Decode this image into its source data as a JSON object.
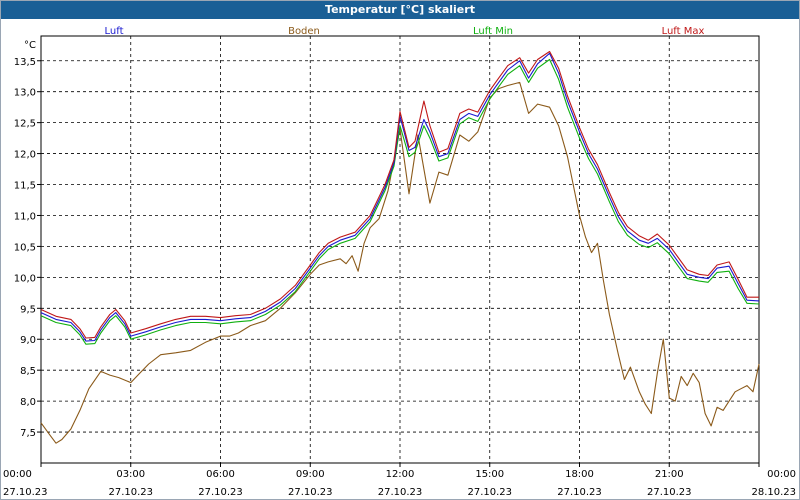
{
  "window": {
    "title": "Temperatur [°C] skaliert"
  },
  "chart_data": {
    "type": "line",
    "title": "Temperatur [°C] skaliert",
    "ylabel": "°C",
    "xlabel": "",
    "ylim": [
      7.0,
      13.9
    ],
    "grid": true,
    "legend": "top",
    "y_ticks": [
      "7,5",
      "8,0",
      "8,5",
      "9,0",
      "9,5",
      "10,0",
      "10,5",
      "11,0",
      "11,5",
      "12,0",
      "12,5",
      "13,0",
      "13,5"
    ],
    "x_ticks": [
      {
        "h": 0,
        "time": "00:00",
        "date": "27.10.23"
      },
      {
        "h": 3,
        "time": "03:00",
        "date": "27.10.23"
      },
      {
        "h": 6,
        "time": "06:00",
        "date": "27.10.23"
      },
      {
        "h": 9,
        "time": "09:00",
        "date": "27.10.23"
      },
      {
        "h": 12,
        "time": "12:00",
        "date": "27.10.23"
      },
      {
        "h": 15,
        "time": "15:00",
        "date": "27.10.23"
      },
      {
        "h": 18,
        "time": "18:00",
        "date": "27.10.23"
      },
      {
        "h": 21,
        "time": "21:00",
        "date": "27.10.23"
      },
      {
        "h": 24,
        "time": "00:00",
        "date": "28.10.23"
      }
    ],
    "series": [
      {
        "name": "Luft",
        "color": "#1a1ad0",
        "x": [
          0,
          0.5,
          1,
          1.3,
          1.5,
          1.8,
          2,
          2.3,
          2.5,
          2.8,
          3,
          3.5,
          4,
          4.5,
          5,
          5.5,
          6,
          6.5,
          7,
          7.5,
          8,
          8.5,
          9,
          9.3,
          9.6,
          10,
          10.5,
          11,
          11.5,
          11.8,
          12,
          12.3,
          12.5,
          12.8,
          13,
          13.3,
          13.6,
          14,
          14.3,
          14.6,
          15,
          15.3,
          15.6,
          16,
          16.3,
          16.6,
          17,
          17.3,
          17.6,
          18,
          18.3,
          18.6,
          19,
          19.3,
          19.6,
          20,
          20.3,
          20.6,
          21,
          21.3,
          21.6,
          22,
          22.3,
          22.6,
          23,
          23.3,
          23.6,
          24
        ],
        "values": [
          9.43,
          9.32,
          9.27,
          9.12,
          8.97,
          8.98,
          9.15,
          9.35,
          9.43,
          9.25,
          9.05,
          9.12,
          9.2,
          9.27,
          9.32,
          9.32,
          9.3,
          9.33,
          9.35,
          9.45,
          9.6,
          9.82,
          10.15,
          10.35,
          10.5,
          10.6,
          10.68,
          10.95,
          11.45,
          11.85,
          12.6,
          12.05,
          12.1,
          12.55,
          12.35,
          11.95,
          12.0,
          12.55,
          12.65,
          12.6,
          12.95,
          13.15,
          13.35,
          13.5,
          13.22,
          13.45,
          13.62,
          13.3,
          12.85,
          12.35,
          12.0,
          11.75,
          11.3,
          10.98,
          10.75,
          10.6,
          10.55,
          10.63,
          10.45,
          10.25,
          10.05,
          10.0,
          9.98,
          10.15,
          10.18,
          9.9,
          9.63,
          9.62
        ]
      },
      {
        "name": "Boden",
        "color": "#8b5a1a",
        "x": [
          0,
          0.3,
          0.5,
          0.7,
          1,
          1.3,
          1.6,
          2,
          2.3,
          2.6,
          3,
          3.3,
          3.6,
          4,
          4.5,
          5,
          5.5,
          6,
          6.3,
          6.6,
          7,
          7.5,
          8,
          8.5,
          9,
          9.3,
          9.6,
          10,
          10.2,
          10.4,
          10.6,
          10.8,
          11,
          11.3,
          11.6,
          12,
          12.3,
          12.6,
          13,
          13.3,
          13.6,
          14,
          14.3,
          14.6,
          15,
          15.3,
          15.6,
          16,
          16.3,
          16.6,
          17,
          17.3,
          17.6,
          18,
          18.2,
          18.4,
          18.6,
          18.8,
          19,
          19.3,
          19.5,
          19.7,
          20,
          20.2,
          20.4,
          20.6,
          20.8,
          21,
          21.2,
          21.4,
          21.6,
          21.8,
          22,
          22.2,
          22.4,
          22.6,
          22.8,
          23,
          23.2,
          23.4,
          23.6,
          23.8,
          24
        ],
        "values": [
          7.65,
          7.45,
          7.32,
          7.38,
          7.55,
          7.85,
          8.2,
          8.48,
          8.42,
          8.38,
          8.3,
          8.45,
          8.6,
          8.75,
          8.78,
          8.82,
          8.95,
          9.05,
          9.05,
          9.1,
          9.22,
          9.3,
          9.5,
          9.75,
          10.05,
          10.2,
          10.25,
          10.3,
          10.22,
          10.35,
          10.1,
          10.55,
          10.8,
          10.95,
          11.4,
          12.4,
          11.35,
          12.3,
          11.2,
          11.7,
          11.65,
          12.3,
          12.2,
          12.35,
          12.9,
          13.05,
          13.1,
          13.15,
          12.65,
          12.8,
          12.75,
          12.45,
          11.95,
          11.0,
          10.65,
          10.4,
          10.55,
          9.95,
          9.4,
          8.75,
          8.35,
          8.55,
          8.15,
          7.95,
          7.8,
          8.45,
          9.0,
          8.05,
          8.0,
          8.4,
          8.25,
          8.45,
          8.3,
          7.8,
          7.6,
          7.9,
          7.85,
          8.0,
          8.15,
          8.2,
          8.25,
          8.15,
          8.6
        ]
      },
      {
        "name": "Luft Min",
        "color": "#10b010",
        "x": [
          0,
          0.5,
          1,
          1.3,
          1.5,
          1.8,
          2,
          2.3,
          2.5,
          2.8,
          3,
          3.5,
          4,
          4.5,
          5,
          5.5,
          6,
          6.5,
          7,
          7.5,
          8,
          8.5,
          9,
          9.3,
          9.6,
          10,
          10.5,
          11,
          11.5,
          11.8,
          12,
          12.3,
          12.5,
          12.8,
          13,
          13.3,
          13.6,
          14,
          14.3,
          14.6,
          15,
          15.3,
          15.6,
          16,
          16.3,
          16.6,
          17,
          17.3,
          17.6,
          18,
          18.3,
          18.6,
          19,
          19.3,
          19.6,
          20,
          20.3,
          20.6,
          21,
          21.3,
          21.6,
          22,
          22.3,
          22.6,
          23,
          23.3,
          23.6,
          24
        ],
        "values": [
          9.38,
          9.27,
          9.22,
          9.07,
          8.92,
          8.93,
          9.1,
          9.3,
          9.38,
          9.2,
          9.0,
          9.07,
          9.15,
          9.22,
          9.27,
          9.27,
          9.25,
          9.28,
          9.3,
          9.4,
          9.55,
          9.77,
          10.1,
          10.3,
          10.45,
          10.55,
          10.63,
          10.9,
          11.4,
          11.8,
          12.45,
          11.95,
          12.02,
          12.45,
          12.25,
          11.88,
          11.93,
          12.48,
          12.58,
          12.52,
          12.88,
          13.08,
          13.28,
          13.42,
          13.15,
          13.38,
          13.52,
          13.2,
          12.75,
          12.25,
          11.92,
          11.67,
          11.22,
          10.9,
          10.68,
          10.53,
          10.48,
          10.56,
          10.38,
          10.18,
          9.98,
          9.94,
          9.92,
          10.08,
          10.1,
          9.82,
          9.58,
          9.57
        ]
      },
      {
        "name": "Luft Max",
        "color": "#c01818",
        "x": [
          0,
          0.5,
          1,
          1.3,
          1.5,
          1.8,
          2,
          2.3,
          2.5,
          2.8,
          3,
          3.5,
          4,
          4.5,
          5,
          5.5,
          6,
          6.5,
          7,
          7.5,
          8,
          8.5,
          9,
          9.3,
          9.6,
          10,
          10.5,
          11,
          11.5,
          11.8,
          12,
          12.3,
          12.5,
          12.8,
          13,
          13.3,
          13.6,
          14,
          14.3,
          14.6,
          15,
          15.3,
          15.6,
          16,
          16.3,
          16.6,
          17,
          17.3,
          17.6,
          18,
          18.3,
          18.6,
          19,
          19.3,
          19.6,
          20,
          20.3,
          20.6,
          21,
          21.3,
          21.6,
          22,
          22.3,
          22.6,
          23,
          23.3,
          23.6,
          24
        ],
        "values": [
          9.48,
          9.37,
          9.32,
          9.17,
          9.02,
          9.03,
          9.2,
          9.4,
          9.48,
          9.3,
          9.1,
          9.17,
          9.25,
          9.32,
          9.37,
          9.37,
          9.35,
          9.38,
          9.4,
          9.5,
          9.65,
          9.87,
          10.2,
          10.4,
          10.55,
          10.65,
          10.73,
          11.0,
          11.5,
          11.9,
          12.68,
          12.1,
          12.2,
          12.85,
          12.45,
          12.02,
          12.08,
          12.65,
          12.72,
          12.67,
          13.02,
          13.22,
          13.42,
          13.55,
          13.3,
          13.52,
          13.65,
          13.38,
          12.93,
          12.42,
          12.07,
          11.82,
          11.37,
          11.05,
          10.82,
          10.67,
          10.6,
          10.7,
          10.52,
          10.32,
          10.12,
          10.05,
          10.03,
          10.2,
          10.25,
          9.97,
          9.68,
          9.68
        ]
      }
    ]
  }
}
